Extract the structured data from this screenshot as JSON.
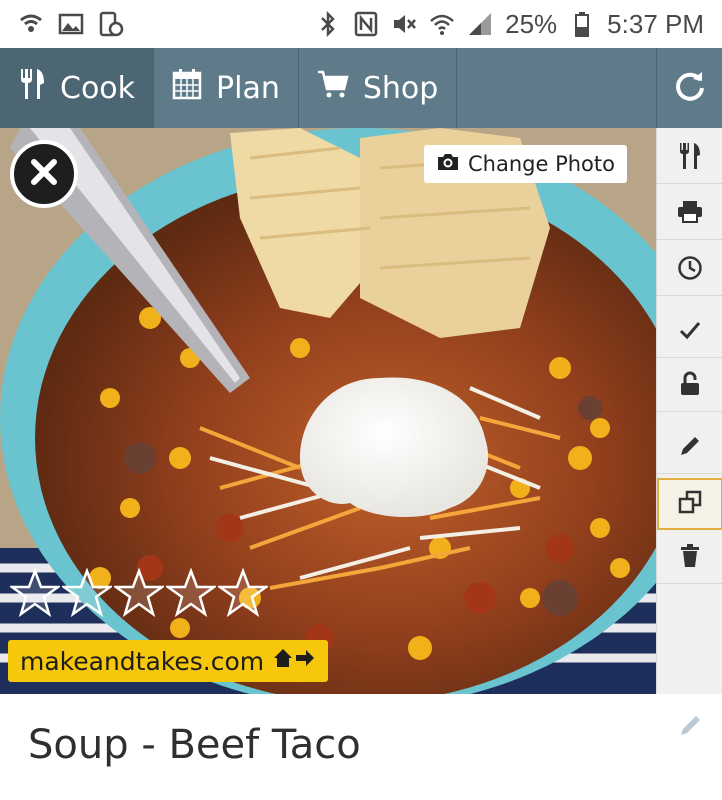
{
  "status_bar": {
    "battery_percent": "25%",
    "time": "5:37 PM",
    "icons_left": [
      "wifi-call-icon",
      "image-icon",
      "phone-clock-icon"
    ],
    "icons_right": [
      "bluetooth-icon",
      "nfc-icon",
      "mute-icon",
      "wifi-icon",
      "signal-icon",
      "battery-icon"
    ]
  },
  "nav": {
    "tabs": [
      {
        "label": "Cook",
        "icon": "cook-icon"
      },
      {
        "label": "Plan",
        "icon": "calendar-icon"
      },
      {
        "label": "Shop",
        "icon": "cart-icon"
      }
    ],
    "refresh_icon": "refresh-icon"
  },
  "photo": {
    "change_photo_label": "Change Photo",
    "rating": 0,
    "rating_max": 5,
    "source_label": "makeandtakes.com"
  },
  "sidebar": {
    "buttons": [
      "utensils-icon",
      "printer-icon",
      "clock-icon",
      "check-icon",
      "lock-icon",
      "pencil-icon",
      "copy-icon",
      "trash-icon"
    ],
    "active_button": "copy-icon"
  },
  "recipe": {
    "title": "Soup - Beef Taco"
  },
  "colors": {
    "nav_bg": "#5f7a88",
    "nav_active": "#4d6673",
    "source_badge": "#f6c70a",
    "sidebar_active_border": "#e3ad3b"
  }
}
